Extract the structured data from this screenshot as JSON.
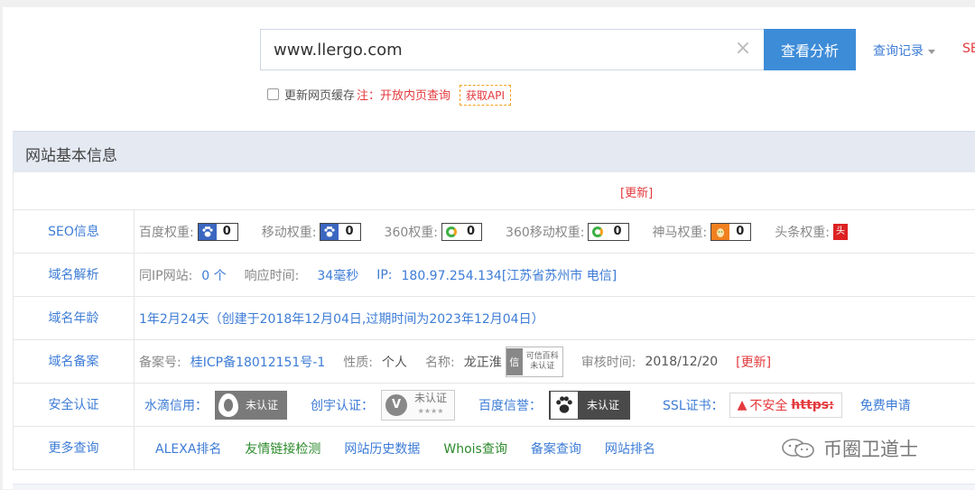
{
  "search": {
    "value": "www.llergo.com",
    "clear_icon": "×",
    "button_label": "查看分析",
    "history_label": "查询记录",
    "seo_label": "SE"
  },
  "options": {
    "cache_label": "更新网页缓存",
    "note": "注：开放内页查询",
    "api_label": "获取API"
  },
  "panel": {
    "title": "网站基本信息",
    "update_label": "[更新]"
  },
  "seo": {
    "label": "SEO信息",
    "baidu_label": "百度权重:",
    "baidu_value": "0",
    "mobile_label": "移动权重:",
    "mobile_value": "0",
    "w360_label": "360权重:",
    "w360_value": "0",
    "w360m_label": "360移动权重:",
    "w360m_value": "0",
    "shenma_label": "神马权重:",
    "shenma_value": "0",
    "toutiao_label": "头条权重:",
    "toutiao_icon": "头"
  },
  "dns": {
    "label": "域名解析",
    "sameip_label": "同IP网站:",
    "sameip_value": "0 个",
    "resp_label": "响应时间:",
    "resp_value": "34毫秒",
    "ip_label": "IP:",
    "ip_value": "180.97.254.134[江苏省苏州市 电信]"
  },
  "age": {
    "label": "域名年龄",
    "value": "1年2月24天（创建于2018年12月04日,过期时间为2023年12月04日）"
  },
  "icp": {
    "label": "域名备案",
    "no_label": "备案号:",
    "no_value": "桂ICP备18012151号-1",
    "nature_label": "性质:",
    "nature_value": "个人",
    "name_label": "名称:",
    "name_value": "龙正淮",
    "badge_logo": "信",
    "badge_line1": "可信百科",
    "badge_line2": "未认证",
    "audit_label": "审核时间:",
    "audit_value": "2018/12/20",
    "update_label": "[更新]"
  },
  "security": {
    "label": "安全认证",
    "shuidi_label": "水滴信用：",
    "shuidi_status": "未认证",
    "chuangyu_label": "创宇认证：",
    "chuangyu_logo": "V",
    "chuangyu_status": "未认证",
    "chuangyu_stars": "★★★★",
    "baidu_label": "百度信誉：",
    "baidu_status": "未认证",
    "ssl_label": "SSL证书：",
    "ssl_warn": "▲",
    "ssl_status": "不安全",
    "ssl_https": "https:",
    "free_label": "免费申请"
  },
  "more": {
    "label": "更多查询",
    "links": [
      "ALEXA排名",
      "友情链接检测",
      "网站历史数据",
      "Whois查询",
      "备案查询",
      "网站排名"
    ]
  },
  "watermark": {
    "text": "币圈卫道士"
  },
  "colors": {
    "accent": "#3d8cd8",
    "link": "#3d7cd6",
    "alert": "#e4393c",
    "green_link": "#2b8a2b",
    "panel_header": "#e4e9f2"
  }
}
